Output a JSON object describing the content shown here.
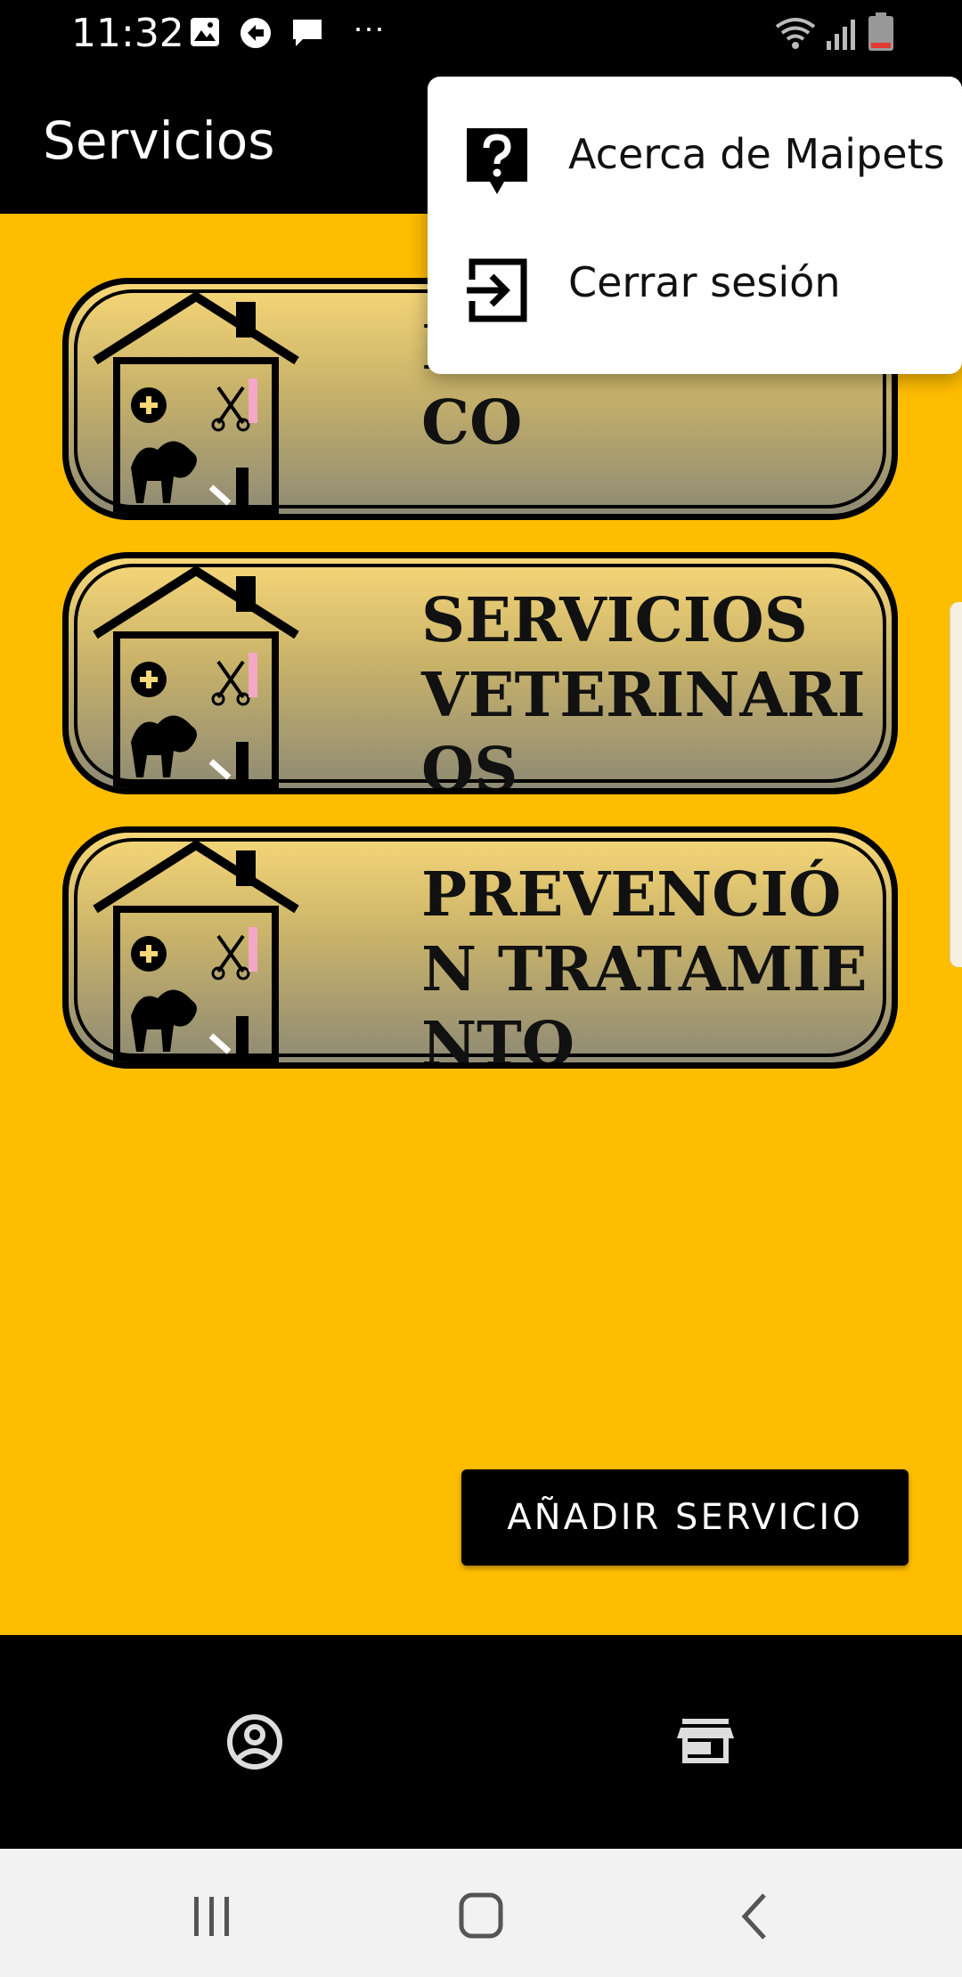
{
  "status_bar": {
    "time": "11:32",
    "icons": [
      "gallery-icon",
      "browser-icon",
      "message-icon",
      "more-dots-icon",
      "wifi-icon",
      "signal-icon",
      "battery-icon"
    ],
    "more": "···"
  },
  "app_bar": {
    "title": "Servicios"
  },
  "services": [
    {
      "label": "DIAGNOSTICO",
      "logo": "pet-house-logo"
    },
    {
      "label": "SERVICIOS VETERINARIOS",
      "logo": "pet-house-logo"
    },
    {
      "label": "PREVENCIÓN TRATAMIENTO",
      "logo": "pet-house-logo"
    }
  ],
  "actions": {
    "add_service": "AÑADIR SERVICIO"
  },
  "bottom_nav": {
    "items": [
      "profile-icon",
      "store-icon"
    ]
  },
  "overflow_menu": {
    "items": [
      {
        "label": "Acerca de Maipets",
        "icon": "help-icon"
      },
      {
        "label": "Cerrar sesión",
        "icon": "logout-icon"
      }
    ]
  },
  "colors": {
    "background": "#FFBD00",
    "bars": "#000000",
    "system_nav": "#F2F2F2"
  }
}
